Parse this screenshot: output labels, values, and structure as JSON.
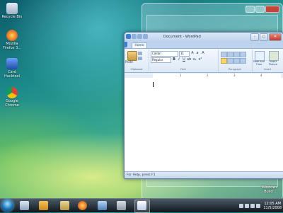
{
  "desktop": {
    "icons": [
      {
        "label": "Recycle Bin",
        "color": "#b8c6d6"
      },
      {
        "label": "Mozilla Firefox 3...",
        "color": "#e8761c"
      },
      {
        "label": "Card Hacktool",
        "color": "#2a5fc4"
      },
      {
        "label": "Google Chrome",
        "color": "#3da84a"
      }
    ],
    "os_logo": {
      "line1": "Windows",
      "line2": "Build ..."
    }
  },
  "wordpad": {
    "title": "Document - WordPad",
    "tab_home": "Home",
    "ribbon": {
      "paste_label": "Paste",
      "clipboard_label": "Clipboard",
      "font_name": "Calibri",
      "font_size": "11",
      "style_value": "Regular",
      "font_label": "Font",
      "paragraph_label": "Paragraph",
      "insert_label": "Insert",
      "date_time_label": "Date and Time",
      "insert_picture_label": "Insert Picture"
    },
    "ruler": [
      "1",
      "2",
      "3",
      "4"
    ],
    "status_text": "For Help, press F1"
  },
  "taskbar": {
    "clock_time": "12:05 AM",
    "clock_date": "11/5/2008"
  },
  "colors": {
    "taskbar": "#10171d",
    "ribbon": "#dde9f6",
    "start_orb": "#1a6fb6"
  }
}
